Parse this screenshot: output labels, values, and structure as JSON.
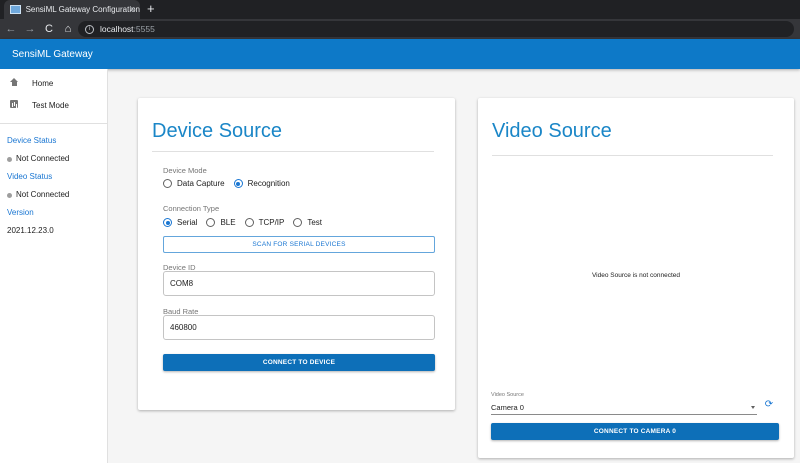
{
  "browser": {
    "tab_title": "SensiML Gateway Configuration",
    "tab_close": "×",
    "new_tab": "+",
    "url_host": "localhost",
    "url_port": ":5555",
    "back": "←",
    "forward": "→",
    "reload": "C",
    "home": "⌂"
  },
  "appbar": {
    "title": "SensiML Gateway"
  },
  "sidebar": {
    "nav": [
      {
        "label": "Home",
        "icon": "home-icon"
      },
      {
        "label": "Test Mode",
        "icon": "test-mode-icon"
      }
    ],
    "device_status_heading": "Device Status",
    "device_status_value": "Not Connected",
    "video_status_heading": "Video Status",
    "video_status_value": "Not Connected",
    "version_heading": "Version",
    "version_value": "2021.12.23.0"
  },
  "device_source": {
    "title": "Device Source",
    "device_mode_label": "Device Mode",
    "device_modes": [
      {
        "label": "Data Capture",
        "checked": false
      },
      {
        "label": "Recognition",
        "checked": true
      }
    ],
    "connection_type_label": "Connection Type",
    "connection_types": [
      {
        "label": "Serial",
        "checked": true
      },
      {
        "label": "BLE",
        "checked": false
      },
      {
        "label": "TCP/IP",
        "checked": false
      },
      {
        "label": "Test",
        "checked": false
      }
    ],
    "scan_button": "SCAN FOR SERIAL DEVICES",
    "device_id_label": "Device ID",
    "device_id_value": "COM8",
    "baud_rate_label": "Baud Rate",
    "baud_rate_value": "460800",
    "connect_button": "CONNECT TO DEVICE"
  },
  "video_source": {
    "title": "Video Source",
    "message": "Video Source is not connected",
    "select_label": "Video Source",
    "select_value": "Camera 0",
    "refresh_icon": "refresh-icon",
    "connect_button": "CONNECT TO CAMERA 0"
  },
  "colors": {
    "appbar": "#0d79c8",
    "accent": "#1976d2",
    "primary_button": "#0d6fb8",
    "title_blue": "#1a86c7"
  }
}
